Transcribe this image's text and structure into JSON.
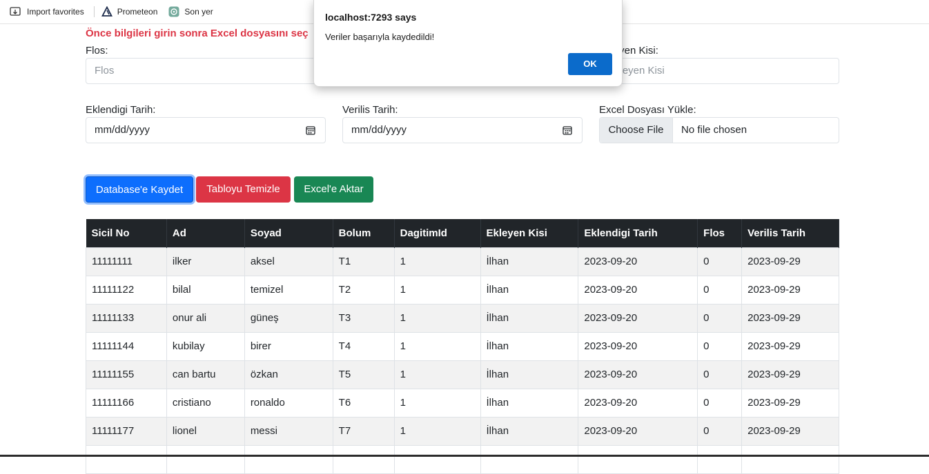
{
  "favorites_bar": {
    "items": [
      {
        "label": "Import favorites",
        "icon": "import-favorites-icon"
      },
      {
        "label": "Prometeon",
        "icon": "prometeon-logo-icon"
      },
      {
        "label": "Son yer",
        "icon": "chatgpt-icon"
      }
    ]
  },
  "form": {
    "instruction": "Önce bilgileri girin sonra Excel dosyasını seç",
    "flos": {
      "label": "Flos:",
      "placeholder": "Flos"
    },
    "ekleyen_kisi": {
      "label": "Ekleyen Kisi:",
      "placeholder": "Ekleyen Kisi"
    },
    "eklendigi_tarih": {
      "label": "Eklendigi Tarih:",
      "value": "mm/dd/yyyy"
    },
    "verilis_tarih": {
      "label": "Verilis Tarih:",
      "value": "mm/dd/yyyy"
    },
    "excel_upload": {
      "label": "Excel Dosyası Yükle:",
      "button": "Choose File",
      "status": "No file chosen"
    }
  },
  "actions": {
    "save_db": "Database'e Kaydet",
    "clear_table": "Tabloyu Temizle",
    "export_excel": "Excel'e Aktar"
  },
  "table": {
    "headers": [
      "Sicil No",
      "Ad",
      "Soyad",
      "Bolum",
      "DagitimId",
      "Ekleyen Kisi",
      "Eklendigi Tarih",
      "Flos",
      "Verilis Tarih"
    ],
    "rows": [
      [
        "11111111",
        "ilker",
        "aksel",
        "T1",
        "1",
        "İlhan",
        "2023-09-20",
        "0",
        "2023-09-29"
      ],
      [
        "11111122",
        "bilal",
        "temizel",
        "T2",
        "1",
        "İlhan",
        "2023-09-20",
        "0",
        "2023-09-29"
      ],
      [
        "11111133",
        "onur ali",
        "güneş",
        "T3",
        "1",
        "İlhan",
        "2023-09-20",
        "0",
        "2023-09-29"
      ],
      [
        "11111144",
        "kubilay",
        "birer",
        "T4",
        "1",
        "İlhan",
        "2023-09-20",
        "0",
        "2023-09-29"
      ],
      [
        "11111155",
        "can bartu",
        "özkan",
        "T5",
        "1",
        "İlhan",
        "2023-09-20",
        "0",
        "2023-09-29"
      ],
      [
        "11111166",
        "cristiano",
        "ronaldo",
        "T6",
        "1",
        "İlhan",
        "2023-09-20",
        "0",
        "2023-09-29"
      ],
      [
        "11111177",
        "lionel",
        "messi",
        "T7",
        "1",
        "İlhan",
        "2023-09-20",
        "0",
        "2023-09-29"
      ]
    ]
  },
  "dialog": {
    "title": "localhost:7293 says",
    "message": "Veriler başarıyla kaydedildi!",
    "ok_label": "OK"
  },
  "colors": {
    "primary": "#0d6efd",
    "danger": "#dc3545",
    "success": "#198754",
    "table_header": "#212529"
  }
}
